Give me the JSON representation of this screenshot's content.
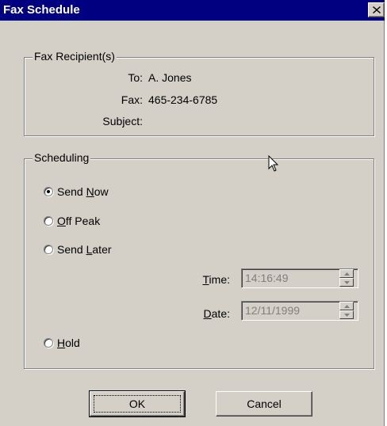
{
  "window": {
    "title": "Fax Schedule",
    "close_glyph": "✕"
  },
  "recipient_group": {
    "legend": "Fax Recipient(s)",
    "to_label": "To:",
    "to_value": "A. Jones",
    "fax_label": "Fax:",
    "fax_value": "465-234-6785",
    "subject_label": "Subject:",
    "subject_value": ""
  },
  "scheduling_group": {
    "legend": "Scheduling",
    "options": [
      {
        "pre": "Send ",
        "mnemonic": "N",
        "post": "ow",
        "selected": true
      },
      {
        "pre": "",
        "mnemonic": "O",
        "post": "ff Peak",
        "selected": false
      },
      {
        "pre": "Send ",
        "mnemonic": "L",
        "post": "ater",
        "selected": false
      },
      {
        "pre": "",
        "mnemonic": "H",
        "post": "old",
        "selected": false
      }
    ],
    "time_label_mnemonic": "T",
    "time_label_rest": "ime:",
    "time_value": "14:16:49",
    "date_label_mnemonic": "D",
    "date_label_rest": "ate:",
    "date_value": "12/11/1999"
  },
  "buttons": {
    "ok": "OK",
    "cancel": "Cancel"
  },
  "icons": {
    "close": "close-icon",
    "cursor": "mouse-pointer-icon",
    "spin_up": "spin-up-icon",
    "spin_down": "spin-down-icon"
  }
}
